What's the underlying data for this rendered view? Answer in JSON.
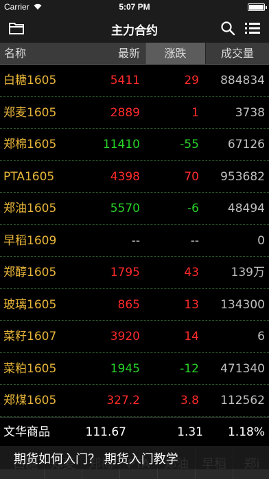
{
  "status": {
    "carrier": "Carrier",
    "time": "5:07 PM"
  },
  "nav": {
    "title": "主力合约"
  },
  "headers": {
    "name": "名称",
    "last": "最新",
    "change": "涨跌",
    "volume": "成交量"
  },
  "rows": [
    {
      "name": "白糖1605",
      "last": "5411",
      "change": "29",
      "volume": "884834",
      "trend": "up"
    },
    {
      "name": "郑麦1605",
      "last": "2889",
      "change": "1",
      "volume": "3738",
      "trend": "up"
    },
    {
      "name": "郑棉1605",
      "last": "11410",
      "change": "-55",
      "volume": "67126",
      "trend": "down"
    },
    {
      "name": "PTA1605",
      "last": "4398",
      "change": "70",
      "volume": "953682",
      "trend": "up"
    },
    {
      "name": "郑油1605",
      "last": "5570",
      "change": "-6",
      "volume": "48494",
      "trend": "down"
    },
    {
      "name": "早稻1609",
      "last": "--",
      "change": "--",
      "volume": "0",
      "trend": "flat"
    },
    {
      "name": "郑醇1605",
      "last": "1795",
      "change": "43",
      "volume": "139万",
      "trend": "up"
    },
    {
      "name": "玻璃1605",
      "last": "865",
      "change": "13",
      "volume": "134300",
      "trend": "up"
    },
    {
      "name": "菜籽1607",
      "last": "3920",
      "change": "14",
      "volume": "6",
      "trend": "up"
    },
    {
      "name": "菜粕1605",
      "last": "1945",
      "change": "-12",
      "volume": "471340",
      "trend": "down"
    },
    {
      "name": "郑煤1605",
      "last": "327.2",
      "change": "3.8",
      "volume": "112562",
      "trend": "up"
    }
  ],
  "index": {
    "name": "文华商品",
    "value": "111.67",
    "change": "1.31",
    "percent": "1.18%"
  },
  "tabs": [
    "白糖",
    "郑麦",
    "郑棉",
    "PTA",
    "郑油",
    "早稻",
    "郑i"
  ],
  "ad": {
    "text": "期货如何入门？ 期货入门教学"
  },
  "colors": {
    "up": "#ff2a2a",
    "down": "#28d228",
    "name": "#e8b53a"
  }
}
